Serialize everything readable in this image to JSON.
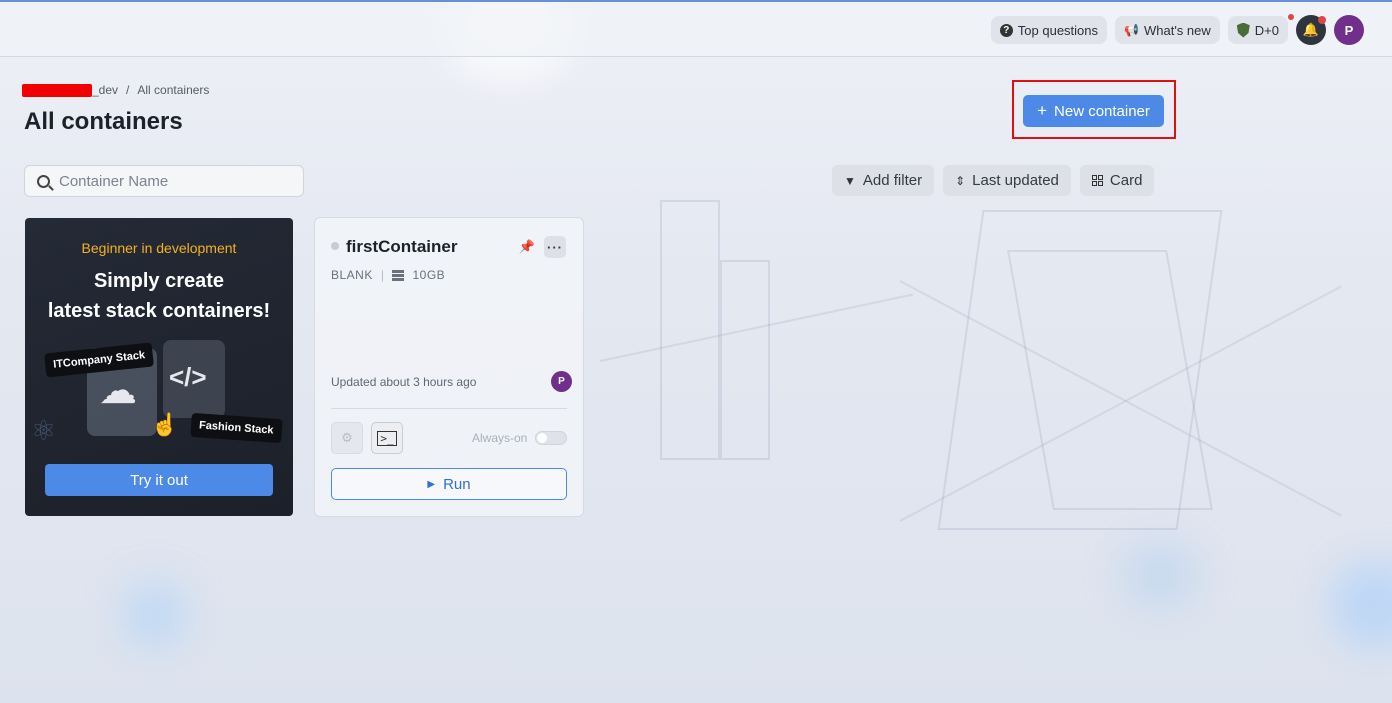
{
  "topbar": {
    "top_questions": "Top questions",
    "whats_new": "What's new",
    "points": "D+0",
    "avatar_initial": "P"
  },
  "breadcrumb": {
    "org_suffix": "_dev",
    "separator": "/",
    "current": "All containers"
  },
  "page": {
    "title": "All containers",
    "new_container_label": "New container"
  },
  "search": {
    "placeholder": "Container Name",
    "value": ""
  },
  "filters": {
    "add_filter": "Add filter",
    "sort": "Last updated",
    "view": "Card"
  },
  "promo": {
    "subtitle": "Beginner in development",
    "title_line1": "Simply create",
    "title_line2": "latest stack containers!",
    "tag_left": "ITCompany Stack",
    "tag_right": "Fashion Stack",
    "cta": "Try it out"
  },
  "containers": [
    {
      "name": "firstContainer",
      "stack": "BLANK",
      "disk": "10GB",
      "updated": "Updated about 3 hours ago",
      "owner_initial": "P",
      "always_on_label": "Always-on",
      "always_on": false,
      "run_label": "Run"
    }
  ],
  "colors": {
    "accent": "#4d8ae8",
    "highlight_frame": "#e01010",
    "promo_subtitle": "#f4b21d",
    "avatar": "#6f2f8a"
  }
}
